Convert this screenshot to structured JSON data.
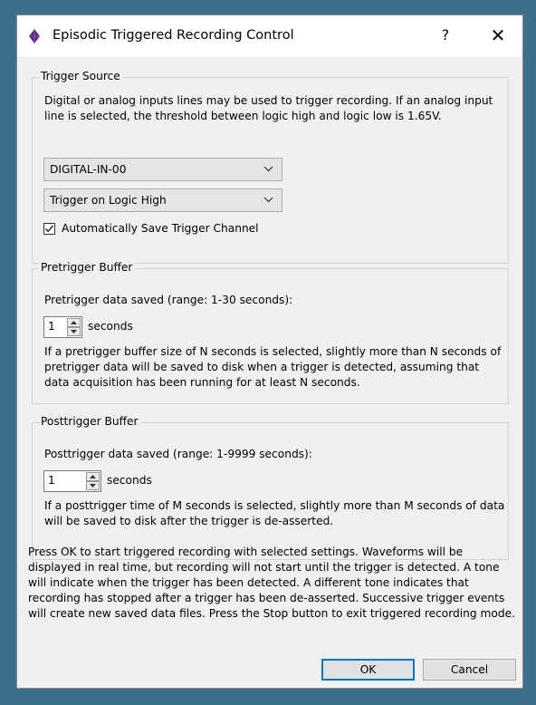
{
  "window": {
    "title": "Episodic Triggered Recording Control",
    "help_glyph": "?",
    "close_glyph": "✕",
    "app_icon": "purple-diamond-icon"
  },
  "trigger_source": {
    "title": "Trigger Source",
    "description": "Digital or analog inputs lines may be used to trigger recording.  If an analog input line is selected, the threshold between logic high and logic low is 1.65V.",
    "channel_select": {
      "value": "DIGITAL-IN-00"
    },
    "polarity_select": {
      "value": "Trigger on Logic High"
    },
    "autosave": {
      "label": "Automatically Save Trigger Channel",
      "checked": true
    }
  },
  "pretrigger": {
    "title": "Pretrigger Buffer",
    "prompt": "Pretrigger data saved (range: 1-30 seconds):",
    "value": "1",
    "unit": "seconds",
    "note": "If a pretrigger buffer size of N seconds is selected, slightly more than N seconds of pretrigger data will be saved to disk when a trigger is detected, assuming that data acquisition has been running for at least N seconds."
  },
  "posttrigger": {
    "title": "Posttrigger Buffer",
    "prompt": "Posttrigger data saved (range: 1-9999 seconds):",
    "value": "1",
    "unit": "seconds",
    "note": "If a posttrigger time of M seconds is selected, slightly more than M seconds of data will be saved to disk after the trigger is de-asserted."
  },
  "instructions": "Press OK to start triggered recording with selected settings.  Waveforms will be displayed in real time, but recording will not start until the trigger is detected.  A tone will indicate when the trigger has been detected.  A different tone indicates that recording has stopped after a trigger has been de-asserted.  Successive trigger events will create new saved data files.  Press the Stop button to exit triggered recording mode.",
  "buttons": {
    "ok": "OK",
    "cancel": "Cancel"
  },
  "colors": {
    "accent": "#0078d7",
    "desktop": "#3c6f8c",
    "dialog": "#f0f0f0",
    "icon": "#5a2a7a"
  }
}
